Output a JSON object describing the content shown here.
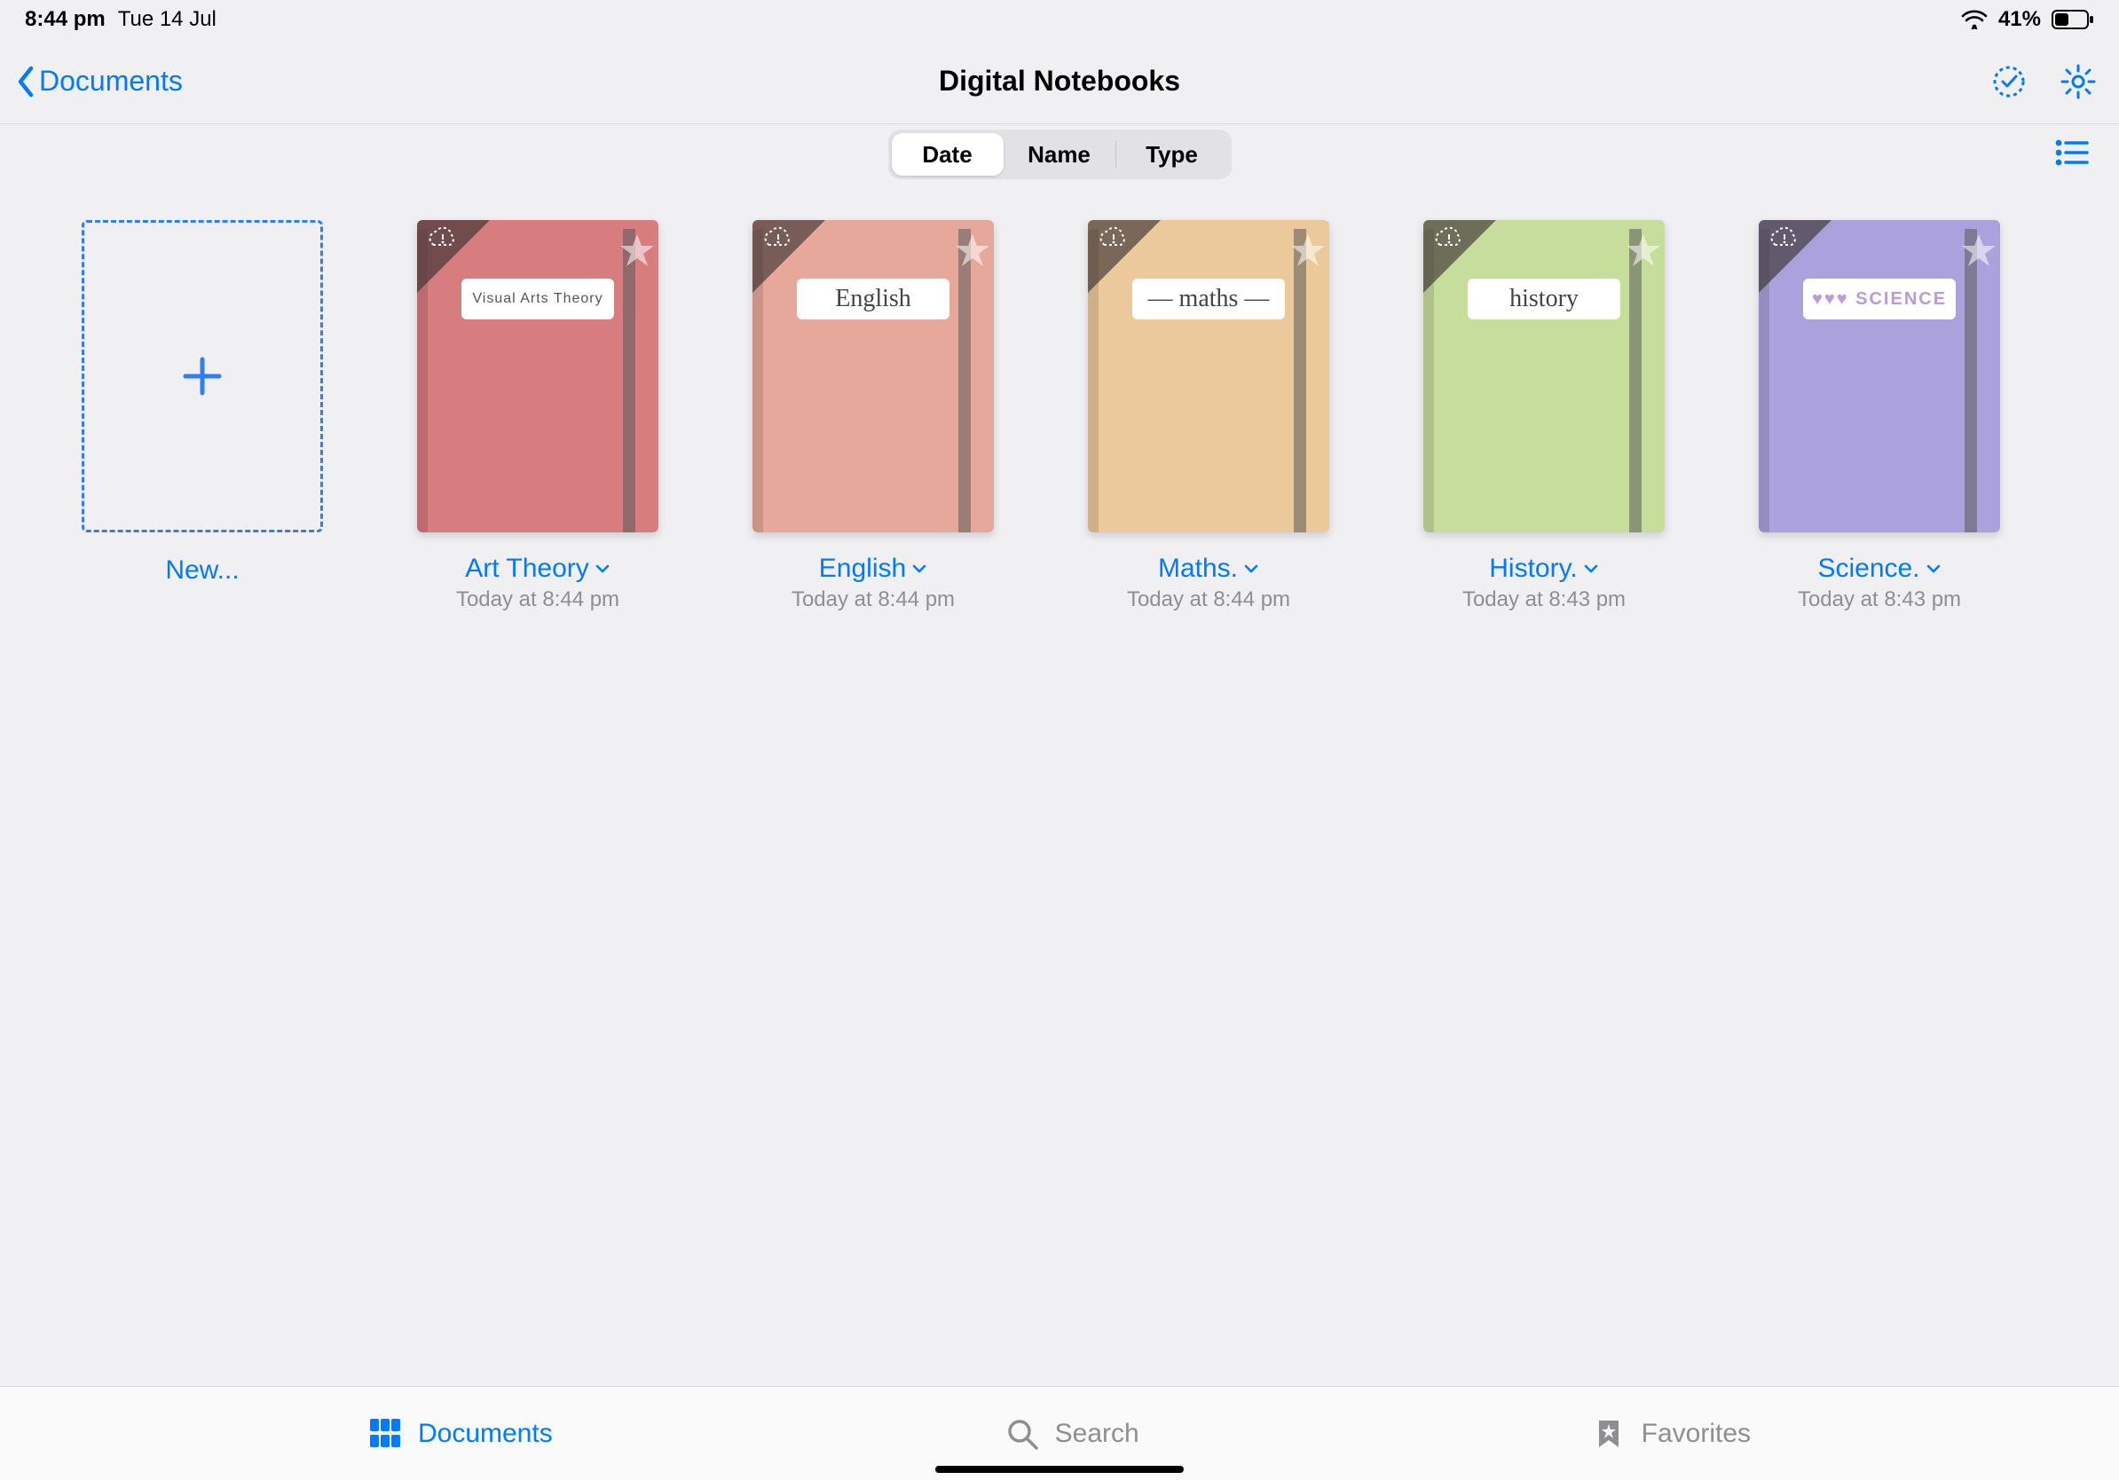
{
  "status": {
    "time": "8:44 pm",
    "date": "Tue 14 Jul",
    "battery_pct": "41%"
  },
  "header": {
    "back_label": "Documents",
    "title": "Digital Notebooks"
  },
  "sort": {
    "options": [
      "Date",
      "Name",
      "Type"
    ],
    "selected": "Date"
  },
  "new_label": "New...",
  "notebooks": [
    {
      "title": "Art Theory",
      "cover_label": "Visual Arts Theory",
      "subtitle": "Today at 8:44 pm",
      "color": "#d77c7f",
      "label_class": "small"
    },
    {
      "title": "English",
      "cover_label": "English",
      "subtitle": "Today at 8:44 pm",
      "color": "#e6a89a",
      "label_class": "cursive"
    },
    {
      "title": "Maths.",
      "cover_label": "— maths —",
      "subtitle": "Today at 8:44 pm",
      "color": "#ecc99a",
      "label_class": "cursive"
    },
    {
      "title": "History.",
      "cover_label": "history",
      "subtitle": "Today at 8:43 pm",
      "color": "#c6dd9c",
      "label_class": "cursive"
    },
    {
      "title": "Science.",
      "cover_label": "♥♥♥ SCIENCE",
      "subtitle": "Today at 8:43 pm",
      "color": "#aaa1dd",
      "label_class": "sci"
    }
  ],
  "tabs": {
    "documents": "Documents",
    "search": "Search",
    "favorites": "Favorites"
  }
}
